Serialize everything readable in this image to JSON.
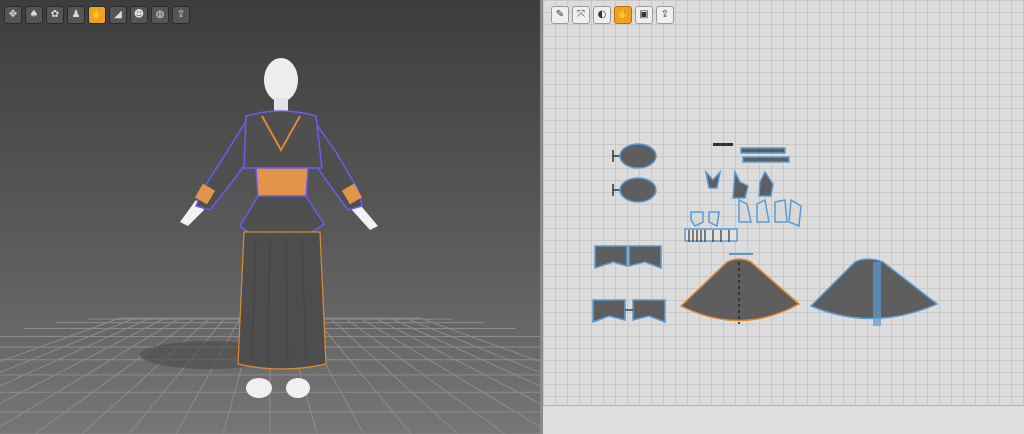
{
  "viewport_3d": {
    "toolbar": [
      {
        "icon": "transform-icon",
        "glyph": "✥",
        "active": false
      },
      {
        "icon": "garment-icon",
        "glyph": "♠",
        "active": false
      },
      {
        "icon": "arrange-icon",
        "glyph": "✿",
        "active": false
      },
      {
        "icon": "avatar-icon",
        "glyph": "♟",
        "active": false
      },
      {
        "icon": "pattern-select-icon",
        "glyph": "✋",
        "active": true
      },
      {
        "icon": "pin-icon",
        "glyph": "◢",
        "active": false
      },
      {
        "icon": "avatar-pose-icon",
        "glyph": "☻",
        "active": false
      },
      {
        "icon": "texture-icon",
        "glyph": "◍",
        "active": false
      },
      {
        "icon": "export-icon",
        "glyph": "⇪",
        "active": false
      }
    ]
  },
  "viewport_2d": {
    "toolbar": [
      {
        "icon": "edit-pattern-icon",
        "glyph": "✎",
        "active": false
      },
      {
        "icon": "transform-pattern-icon",
        "glyph": "⤧",
        "active": false
      },
      {
        "icon": "segment-icon",
        "glyph": "◐",
        "active": false
      },
      {
        "icon": "select-mesh-icon",
        "glyph": "✋",
        "active": true
      },
      {
        "icon": "lock-icon",
        "glyph": "▣",
        "active": false
      },
      {
        "icon": "export-2d-icon",
        "glyph": "⇪",
        "active": false
      }
    ]
  },
  "colors": {
    "garment": "#4f4f4f",
    "seam_orange": "#e08a30",
    "seam_purple": "#6b5cf0",
    "corset": "#e2954a",
    "piece_edge": "#5b9bd5",
    "avatar": "#e8e8e8"
  }
}
